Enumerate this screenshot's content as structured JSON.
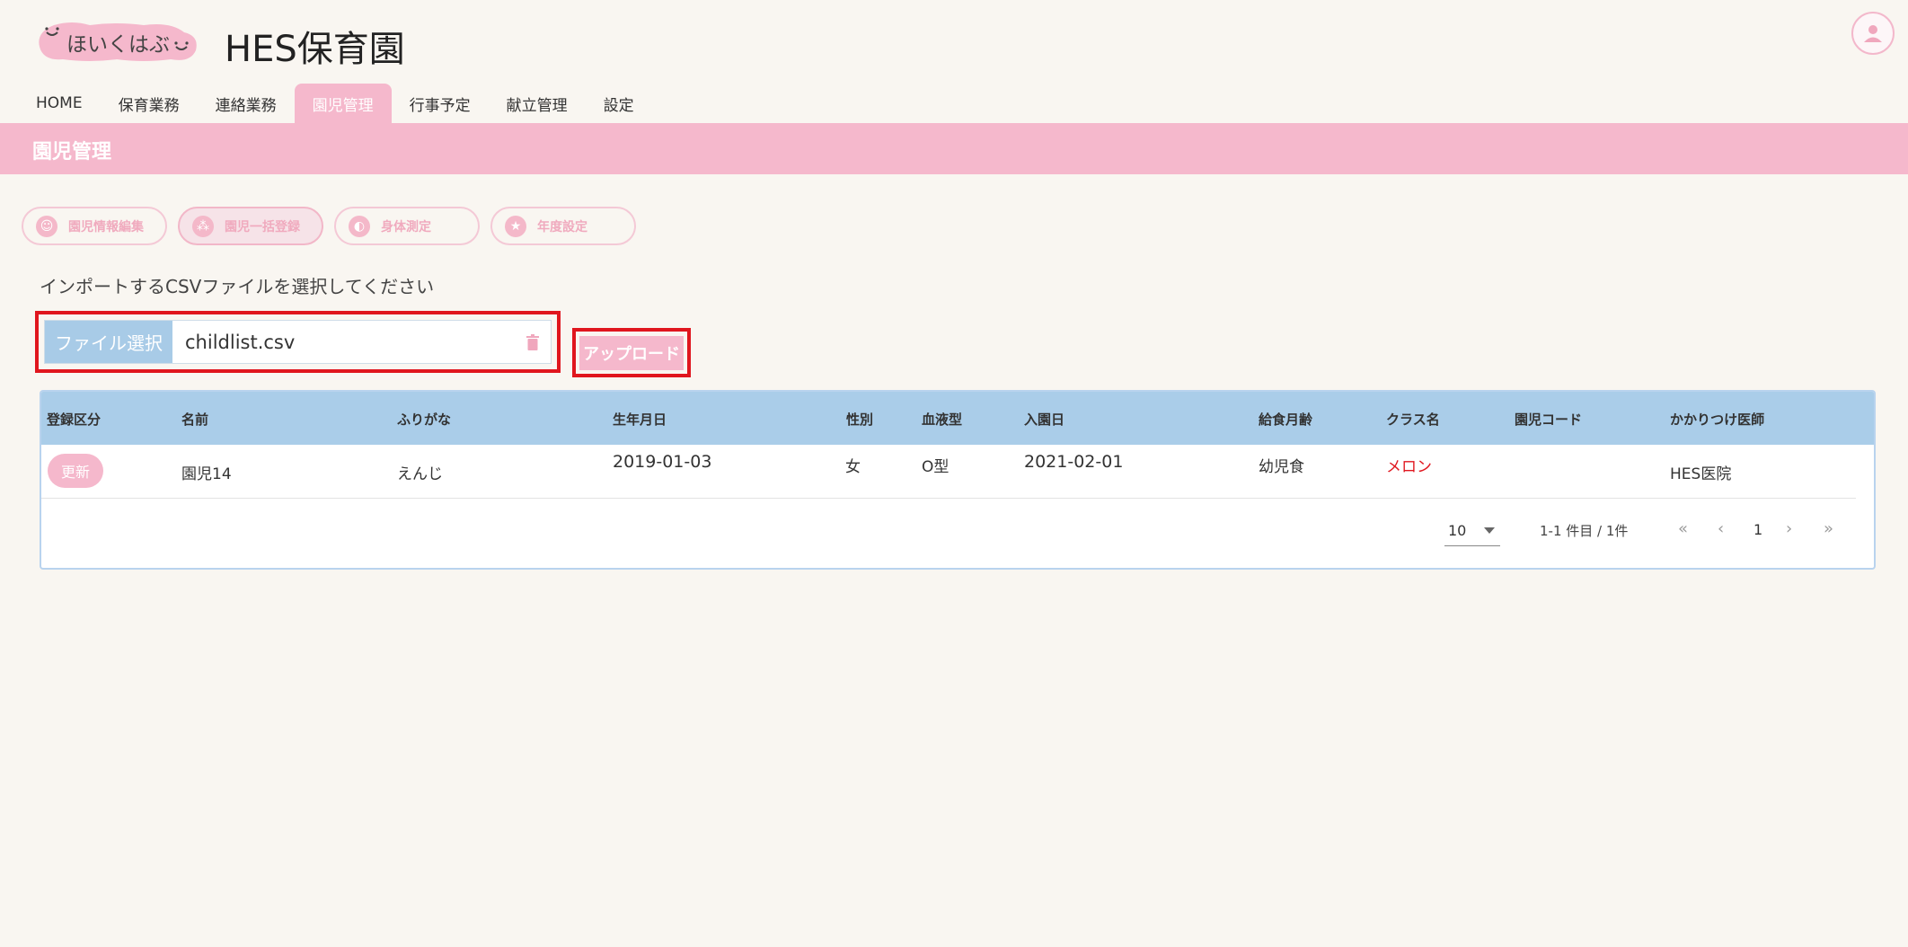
{
  "header": {
    "logo_text": "ほいくはぶ",
    "org_name": "HES保育園",
    "user_icon": "person-icon"
  },
  "nav": {
    "items": [
      "HOME",
      "保育業務",
      "連絡業務",
      "園児管理",
      "行事予定",
      "献立管理",
      "設定"
    ],
    "active_index": 3
  },
  "section": {
    "title": "園児管理"
  },
  "actions": [
    {
      "label": "園児情報編集",
      "icon": "child-face-icon",
      "active": false
    },
    {
      "label": "園児一括登録",
      "icon": "group-icon",
      "active": true
    },
    {
      "label": "身体測定",
      "icon": "measure-icon",
      "active": false
    },
    {
      "label": "年度設定",
      "icon": "star-icon",
      "active": false
    }
  ],
  "import": {
    "instruction": "インポートするCSVファイルを選択してください",
    "select_label": "ファイル選択",
    "file_name": "childlist.csv",
    "upload_label": "アップロード"
  },
  "table": {
    "headers": [
      "登録区分",
      "名前",
      "ふりがな",
      "生年月日",
      "性別",
      "血液型",
      "入園日",
      "給食月齢",
      "クラス名",
      "園児コード",
      "かかりつけ医師"
    ],
    "rows": [
      {
        "type": "更新",
        "name": "園児14",
        "kana": "えんじ",
        "birth": "2019-01-03",
        "sex": "女",
        "blood": "O型",
        "enroll": "2021-02-01",
        "meal": "幼児食",
        "class": "メロン",
        "code": "",
        "doctor": "HES医院"
      }
    ]
  },
  "pagination": {
    "per_page": "10",
    "range": "1-1 件目 / 1件",
    "current_page": "1"
  },
  "colors": {
    "accent_pink": "#f5b8cc",
    "header_blue": "#aacde9",
    "highlight_red": "#e0161e",
    "background": "#f9f6f1"
  }
}
